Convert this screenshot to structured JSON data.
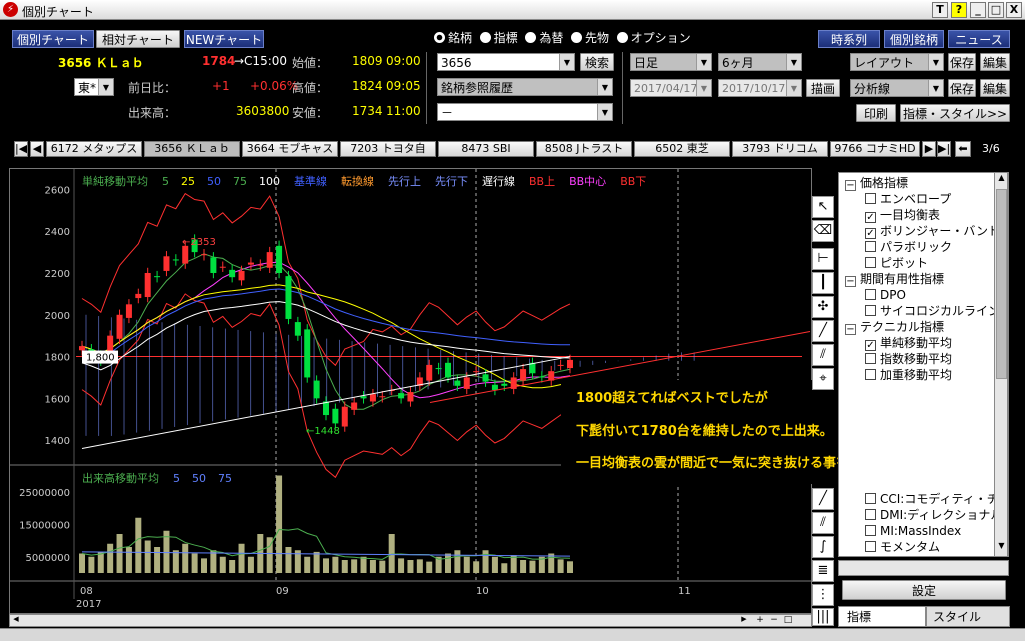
{
  "window": {
    "title": "個別チャート",
    "buttons": [
      "T",
      "?",
      "_",
      "□",
      "X"
    ]
  },
  "toolbar": {
    "tab1": "個別チャート",
    "tab2": "相対チャート",
    "tab3": "NEWチャート"
  },
  "quote": {
    "code_name": "3656 ＫＬａｂ",
    "price": "1784",
    "change_arrow": "→C15:00",
    "exchange": "東*",
    "prev_label": "前日比：",
    "prev_change": "+1",
    "prev_pct": "+0.06%",
    "volume_label": "出来高：",
    "volume": "3603800",
    "open_label": "始値：",
    "open": "1809",
    "open_time": "09:00",
    "high_label": "高値：",
    "high": "1824",
    "high_time": "09:05",
    "low_label": "安値：",
    "low": "1734",
    "low_time": "11:00"
  },
  "market": {
    "options": [
      "銘柄",
      "指標",
      "為替",
      "先物",
      "オプション"
    ],
    "selected": 0
  },
  "search": {
    "value": "3656",
    "button": "検索",
    "history": "銘柄参照履歴",
    "blank": "－"
  },
  "period": {
    "interval": "日足",
    "range": "6ヶ月",
    "start": "2017/04/17",
    "end": "2017/10/17",
    "draw": "描画"
  },
  "rightbtns": {
    "timeseries": "時系列",
    "individual": "個別銘柄",
    "news": "ニュース",
    "layout": "レイアウト",
    "save": "保存",
    "edit": "編集",
    "analysis": "分析線",
    "print": "印刷",
    "indstyle": "指標・スタイル>>"
  },
  "tabs": [
    "6172 メタップス",
    "3656 ＫＬａｂ",
    "3664 モブキャス",
    "7203 トヨタ自",
    "8473 SBI",
    "8508 Jトラスト",
    "6502 東芝",
    "3793 ドリコム",
    "9766 コナミHD"
  ],
  "tab_page": "3/6",
  "legend": [
    {
      "t": "単純移動平均",
      "c": "#4caf50"
    },
    {
      "t": "5",
      "c": "#4caf50"
    },
    {
      "t": "25",
      "c": "#ffff00"
    },
    {
      "t": "50",
      "c": "#4060ff"
    },
    {
      "t": "75",
      "c": "#4caf50"
    },
    {
      "t": "100",
      "c": "#ffffff"
    },
    {
      "t": "基準線",
      "c": "#4060ff"
    },
    {
      "t": "転換線",
      "c": "#ff9a2e"
    },
    {
      "t": "先行上",
      "c": "#7a90ff"
    },
    {
      "t": "先行下",
      "c": "#7a90ff"
    },
    {
      "t": "遅行線",
      "c": "#ffffff"
    },
    {
      "t": "BB上",
      "c": "#ff3030"
    },
    {
      "t": "BB中心",
      "c": "#ff40ff"
    },
    {
      "t": "BB下",
      "c": "#ff3030"
    }
  ],
  "vol_legend": [
    {
      "t": "出来高移動平均",
      "c": "#4caf50"
    },
    {
      "t": "5",
      "c": "#6080ff"
    },
    {
      "t": "50",
      "c": "#6080ff"
    },
    {
      "t": "75",
      "c": "#6080ff"
    }
  ],
  "price_axis": [
    "2600",
    "2400",
    "2200",
    "2000",
    "1800",
    "1600",
    "1400"
  ],
  "vol_axis": [
    "25000000",
    "15000000",
    "5000000"
  ],
  "x_axis": {
    "months": [
      "08",
      "09",
      "10",
      "11"
    ],
    "year": "2017"
  },
  "annotations": {
    "high": "←2353",
    "low": "←1448",
    "current": "1,800"
  },
  "comment": [
    "1800超えてればベストでしたが",
    "下髭付いて1780台を維持したので上出来。",
    "一目均衡表の雲が間近で一気に突き抜ける事を希望。"
  ],
  "tree": [
    {
      "type": "group",
      "t": "価格指標"
    },
    {
      "type": "item",
      "t": "エンベロープ",
      "c": false
    },
    {
      "type": "item",
      "t": "一目均衡表",
      "c": true
    },
    {
      "type": "item",
      "t": "ボリンジャー・バンド",
      "c": true
    },
    {
      "type": "item",
      "t": "パラボリック",
      "c": false
    },
    {
      "type": "item",
      "t": "ピボット",
      "c": false
    },
    {
      "type": "group",
      "t": "期間有用性指標"
    },
    {
      "type": "item",
      "t": "DPO",
      "c": false
    },
    {
      "type": "item",
      "t": "サイコロジカルライン",
      "c": false
    },
    {
      "type": "group",
      "t": "テクニカル指標"
    },
    {
      "type": "item",
      "t": "単純移動平均",
      "c": true
    },
    {
      "type": "item",
      "t": "指数移動平均",
      "c": false
    },
    {
      "type": "item",
      "t": "加重移動平均",
      "c": false
    }
  ],
  "tree_bottom": [
    {
      "t": "CCI:コモディティ・チャ",
      "c": false
    },
    {
      "t": "DMI:ディレクショナル",
      "c": false
    },
    {
      "t": "MI:MassIndex",
      "c": false
    },
    {
      "t": "モメンタム",
      "c": false
    }
  ],
  "panel_tabs": {
    "setting": "設定",
    "indicator": "指標",
    "style": "スタイル"
  },
  "chart_data": [
    {
      "type": "candlestick",
      "title": "3656 ＫＬａｂ",
      "categories": [
        "08",
        "09",
        "10"
      ],
      "ohlc_note": "Daily candles Aug–Oct 2017; key labeled values",
      "high_marker": 2353,
      "low_marker": 1448,
      "current_line": 1800,
      "ylim": [
        1300,
        2650
      ],
      "closes": [
        1850,
        1820,
        1780,
        1900,
        2000,
        2050,
        2100,
        2200,
        2180,
        2280,
        2260,
        2330,
        2300,
        2290,
        2200,
        2230,
        2180,
        2210,
        2250,
        2240,
        2300,
        2200,
        1980,
        1900,
        1700,
        1600,
        1520,
        1480,
        1560,
        1580,
        1600,
        1620,
        1610,
        1640,
        1600,
        1630,
        1700,
        1760,
        1740,
        1700,
        1660,
        1700,
        1730,
        1680,
        1640,
        1660,
        1700,
        1740,
        1720,
        1700,
        1730,
        1760,
        1784
      ]
    },
    {
      "type": "bar",
      "title": "出来高",
      "ylim": [
        0,
        32000000
      ],
      "values": [
        6000000,
        5000000,
        6500000,
        9000000,
        12000000,
        8000000,
        17000000,
        10000000,
        8000000,
        13000000,
        7000000,
        9000000,
        6000000,
        4500000,
        7000000,
        5000000,
        4000000,
        9000000,
        5000000,
        12000000,
        11000000,
        30000000,
        8000000,
        7000000,
        5000000,
        6500000,
        4500000,
        5000000,
        4000000,
        4200000,
        5000000,
        4000000,
        3800000,
        12000000,
        4500000,
        4000000,
        4200000,
        3500000,
        5000000,
        6000000,
        7000000,
        5000000,
        3600000,
        7000000,
        5000000,
        3000000,
        5500000,
        4000000,
        3800000,
        5000000,
        6000000,
        4200000,
        3600000
      ]
    }
  ]
}
